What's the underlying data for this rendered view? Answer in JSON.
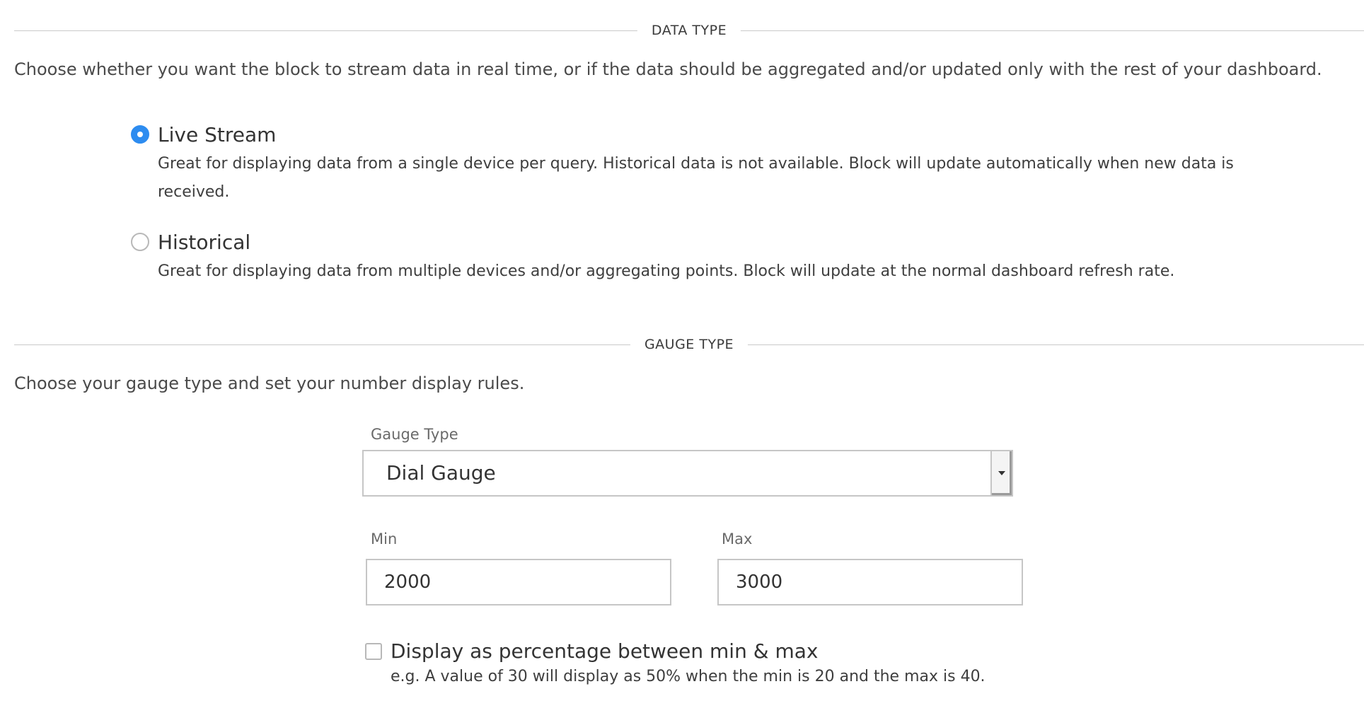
{
  "data_type_section": {
    "heading": "DATA TYPE",
    "description": "Choose whether you want the block to stream data in real time, or if the data should be aggregated and/or updated only with the rest of your dashboard.",
    "options": [
      {
        "label": "Live Stream",
        "help": "Great for displaying data from a single device per query. Historical data is not available. Block will update automatically when new data is received.",
        "selected": true
      },
      {
        "label": "Historical",
        "help": "Great for displaying data from multiple devices and/or aggregating points. Block will update at the normal dashboard refresh rate.",
        "selected": false
      }
    ]
  },
  "gauge_type_section": {
    "heading": "GAUGE TYPE",
    "description": "Choose your gauge type and set your number display rules.",
    "gauge_type": {
      "label": "Gauge Type",
      "selected_value": "Dial Gauge"
    },
    "min": {
      "label": "Min",
      "value": "2000"
    },
    "max": {
      "label": "Max",
      "value": "3000"
    },
    "percentage_option": {
      "label": "Display as percentage between min & max",
      "help": "e.g. A value of 30 will display as 50% when the min is 20 and the max is 40.",
      "checked": false
    }
  },
  "colors": {
    "accent": "#2d8cf0",
    "divider": "#c9c9c9",
    "input_border": "#c6c6c6"
  }
}
